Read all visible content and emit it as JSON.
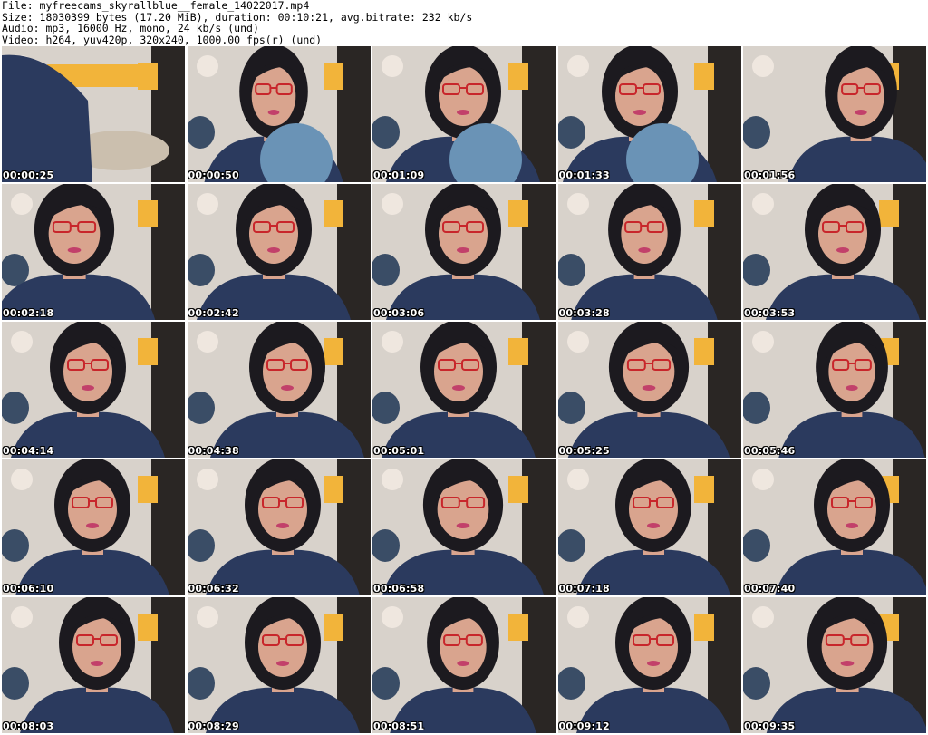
{
  "header": {
    "file_line": "File: myfreecams_skyrallblue__female_14022017.mp4",
    "size_line": "Size: 18030399 bytes (17.20 MiB), duration: 00:10:21, avg.bitrate: 232 kb/s",
    "audio_line": "Audio: mp3, 16000 Hz, mono, 24 kb/s (und)",
    "video_line": "Video: h264, yuv420p, 320x240, 1000.00 fps(r) (und)"
  },
  "thumbnails": [
    {
      "timestamp": "00:00:25"
    },
    {
      "timestamp": "00:00:50"
    },
    {
      "timestamp": "00:01:09"
    },
    {
      "timestamp": "00:01:33"
    },
    {
      "timestamp": "00:01:56"
    },
    {
      "timestamp": "00:02:18"
    },
    {
      "timestamp": "00:02:42"
    },
    {
      "timestamp": "00:03:06"
    },
    {
      "timestamp": "00:03:28"
    },
    {
      "timestamp": "00:03:53"
    },
    {
      "timestamp": "00:04:14"
    },
    {
      "timestamp": "00:04:38"
    },
    {
      "timestamp": "00:05:01"
    },
    {
      "timestamp": "00:05:25"
    },
    {
      "timestamp": "00:05:46"
    },
    {
      "timestamp": "00:06:10"
    },
    {
      "timestamp": "00:06:32"
    },
    {
      "timestamp": "00:06:58"
    },
    {
      "timestamp": "00:07:18"
    },
    {
      "timestamp": "00:07:40"
    },
    {
      "timestamp": "00:08:03"
    },
    {
      "timestamp": "00:08:29"
    },
    {
      "timestamp": "00:08:51"
    },
    {
      "timestamp": "00:09:12"
    },
    {
      "timestamp": "00:09:35"
    }
  ],
  "colors": {
    "background": "#ffffff",
    "wall": "#d8d2cb",
    "hair": "#1c1a1f",
    "skin": "#d9a48e",
    "shirt": "#2b3a5e",
    "glasses": "#c8262b",
    "curtain_yellow": "#f2b43a",
    "dark_corner": "#2a2624",
    "ball": "#6a93b6"
  }
}
